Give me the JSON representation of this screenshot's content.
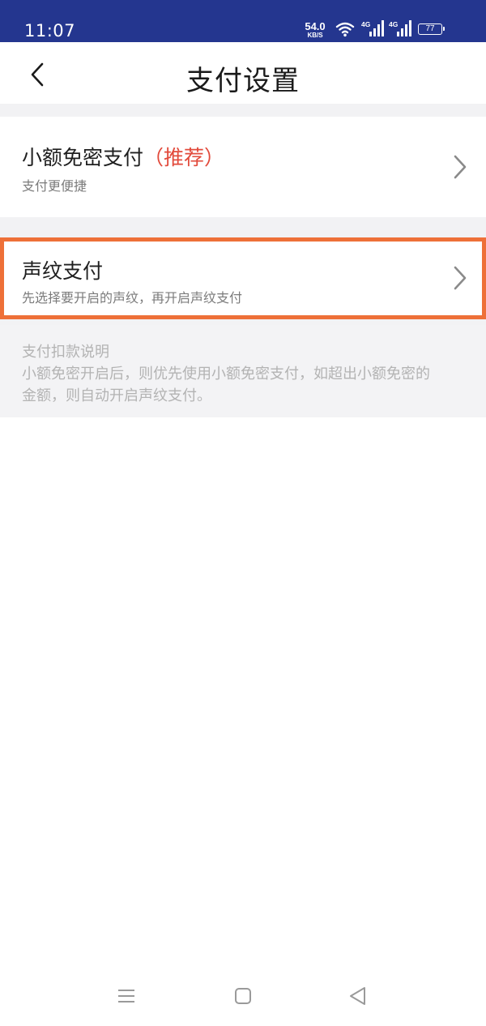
{
  "status_bar": {
    "time": "11:07",
    "net_speed_value": "54.0",
    "net_speed_unit": "KB/S",
    "signal_1": "4G",
    "signal_2": "4G",
    "battery": "77"
  },
  "header": {
    "title": "支付设置"
  },
  "small_amount": {
    "title": "小额免密支付",
    "badge": "（推荐）",
    "subtitle": "支付更便捷"
  },
  "voiceprint": {
    "title": "声纹支付",
    "subtitle": "先选择要开启的声纹，再开启声纹支付"
  },
  "info": {
    "lines": [
      "支付扣款说明",
      "小额免密开启后，则优先使用小额免密支付，如超出小额免密的",
      "金额，则自动开启声纹支付。"
    ]
  },
  "icons": {
    "back": "chevron-left-icon",
    "chevron": "chevron-right-icon",
    "nav_menu": "menu-icon",
    "nav_home": "home-square-icon",
    "nav_back": "back-triangle-icon"
  },
  "colors": {
    "status_bar": "#24368f",
    "recommend": "#e24a3b",
    "highlight_border": "#ee7038",
    "section_gap": "#f2f2f4"
  }
}
